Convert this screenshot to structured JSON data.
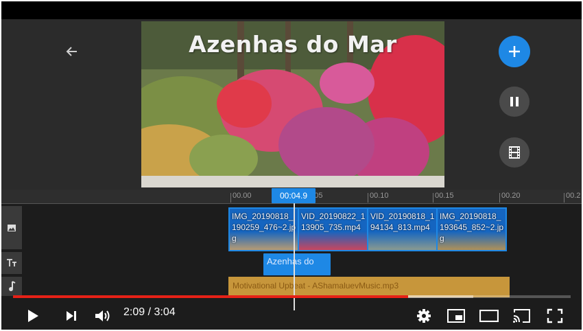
{
  "video": {
    "preview_title": "Azenhas do Mar"
  },
  "timeline": {
    "current_time": "00:04.9",
    "ticks": [
      "00.00",
      "00.05",
      "00.10",
      "00.15",
      "00.20",
      "00.2"
    ],
    "clips": [
      {
        "name": "IMG_20190818_190259_476~2.jpg",
        "bg": "#b79b73"
      },
      {
        "name": "VID_20190822_113905_735.mp4",
        "bg": "#c9465e"
      },
      {
        "name": "VID_20190818_194134_813.mp4",
        "bg": "#8a9a90"
      },
      {
        "name": "IMG_20190818_193645_852~2.jpg",
        "bg": "#b09158"
      }
    ],
    "text_clip": "Azenhas do",
    "audio_clip": "Motivational Upbeat - AShamaluevMusic.mp3"
  },
  "player": {
    "time_display": "2:09 / 3:04",
    "progress_fraction": 0.709,
    "buffer_fraction": 0.825
  },
  "colors": {
    "accent": "#1e88e5",
    "progress": "#e62117",
    "audio": "#c7963b"
  },
  "icons": [
    "back-arrow-icon",
    "add-icon",
    "pause-icon",
    "film-icon",
    "image-track-icon",
    "text-track-icon",
    "music-track-icon",
    "play-icon",
    "next-icon",
    "volume-icon",
    "settings-icon",
    "miniplayer-icon",
    "theater-icon",
    "cast-icon",
    "fullscreen-icon"
  ]
}
